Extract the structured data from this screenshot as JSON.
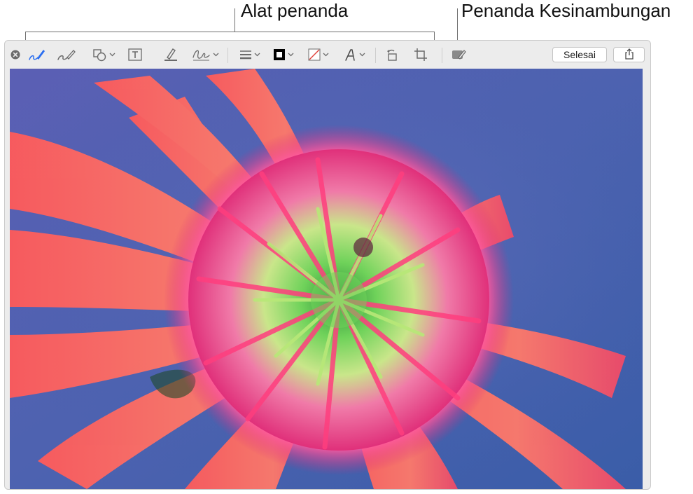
{
  "callouts": {
    "markup_tools": "Alat penanda",
    "markup_continuity": "Penanda Kesinambungan"
  },
  "toolbar": {
    "close_icon": "close-circle-icon",
    "tools": [
      "sketch",
      "draw",
      "shapes",
      "text",
      "highlight",
      "sign",
      "shape-style",
      "border-color",
      "fill-color",
      "text-style",
      "rotate",
      "crop",
      "markup-continuity"
    ],
    "done_label": "Selesai",
    "share_icon": "share-icon",
    "accent_color": "#2a6ef0"
  },
  "image": {
    "subject": "flower-photo"
  }
}
